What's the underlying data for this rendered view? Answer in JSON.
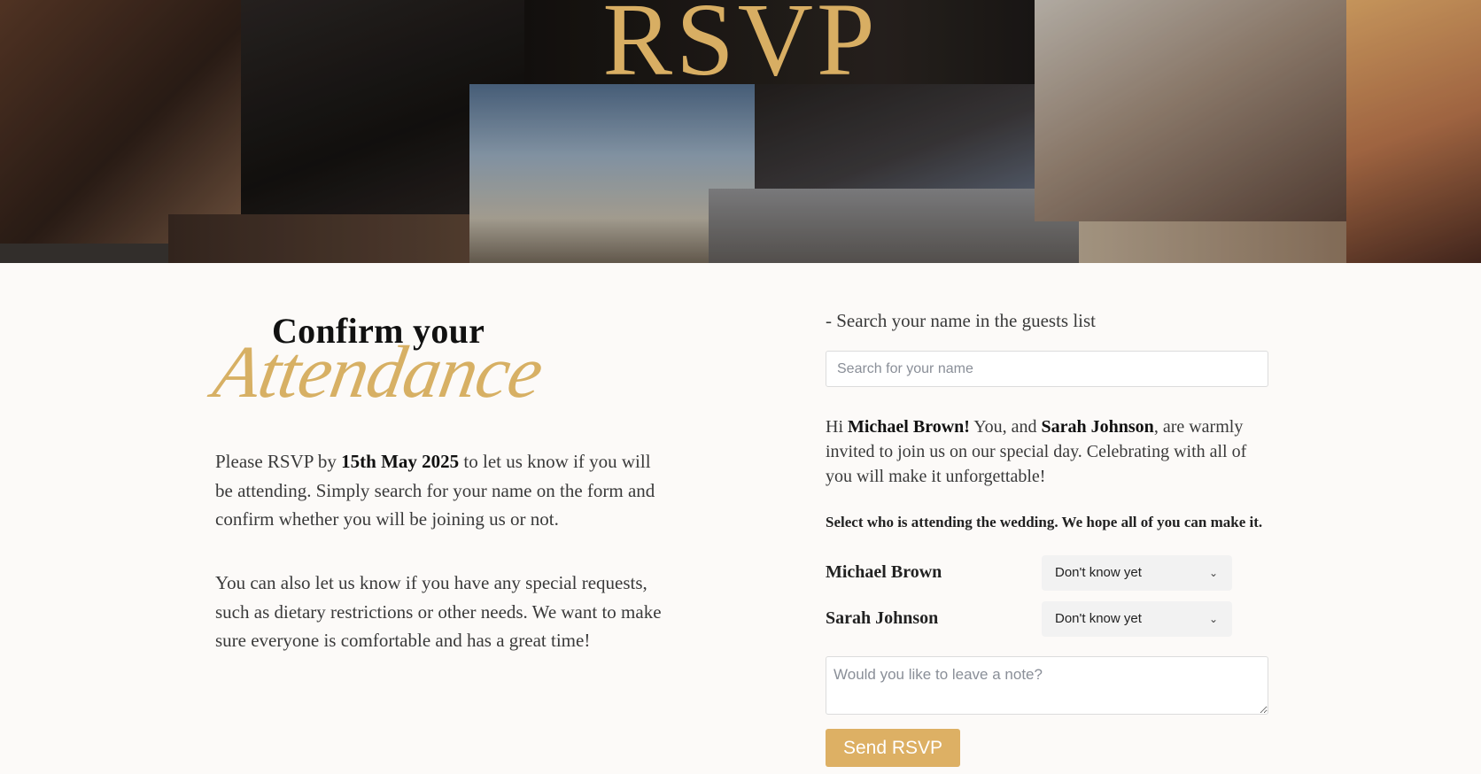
{
  "hero": {
    "title": "RSVP"
  },
  "heading": {
    "line1": "Confirm your",
    "line2": "Attendance"
  },
  "intro": {
    "p1_before": "Please RSVP by ",
    "p1_date": "15th May 2025",
    "p1_after": " to let us know if you will be attending. Simply search for your name on the form and confirm whether you will be joining us or not.",
    "p2": "You can also let us know if you have any special requests, such as dietary restrictions or other needs. We want to make sure everyone is comfortable and has a great time!"
  },
  "form": {
    "search_label": "- Search your name in the guests list",
    "search_placeholder": "Search for your name",
    "greeting_hi": "Hi ",
    "greeting_name": "Michael Brown!",
    "greeting_mid": " You, and ",
    "greeting_partner": "Sarah Johnson",
    "greeting_after": ", are warmly invited to join us on our special day. Celebrating with all of you will make it unforgettable!",
    "select_hint": "Select who is attending the wedding. We hope all of you can make it.",
    "guests": [
      {
        "name": "Michael Brown",
        "status": "Don't know yet"
      },
      {
        "name": "Sarah Johnson",
        "status": "Don't know yet"
      }
    ],
    "note_placeholder": "Would you like to leave a note?",
    "send_label": "Send RSVP"
  },
  "colors": {
    "accent": "#ddb064",
    "title_gold": "#d8ae63",
    "background": "#fcfaf8"
  }
}
